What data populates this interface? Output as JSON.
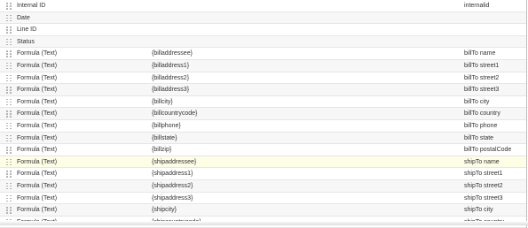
{
  "rows": [
    {
      "field": "Internal ID",
      "formula": "",
      "label": "internalid"
    },
    {
      "field": "Date",
      "formula": "",
      "label": ""
    },
    {
      "field": "Line ID",
      "formula": "",
      "label": ""
    },
    {
      "field": "Status",
      "formula": "",
      "label": ""
    },
    {
      "field": "Formula (Text)",
      "formula": "{billaddressee}",
      "label": "billTo name"
    },
    {
      "field": "Formula (Text)",
      "formula": "{billaddress1}",
      "label": "billTo street1"
    },
    {
      "field": "Formula (Text)",
      "formula": "{billaddress2}",
      "label": "billTo street2"
    },
    {
      "field": "Formula (Text)",
      "formula": "{billaddress3}",
      "label": "billTo street3"
    },
    {
      "field": "Formula (Text)",
      "formula": "{billcity}",
      "label": "billTo city"
    },
    {
      "field": "Formula (Text)",
      "formula": "{billcountrycode}",
      "label": "billTo country"
    },
    {
      "field": "Formula (Text)",
      "formula": "{billphone}",
      "label": "billTo phone"
    },
    {
      "field": "Formula (Text)",
      "formula": "{billstate}",
      "label": "billTo state"
    },
    {
      "field": "Formula (Text)",
      "formula": "{billzip}",
      "label": "billTo postalCode"
    },
    {
      "field": "Formula (Text)",
      "formula": "{shipaddressee}",
      "label": "shipTo name"
    },
    {
      "field": "Formula (Text)",
      "formula": "{shipaddress1}",
      "label": "shipTo street1"
    },
    {
      "field": "Formula (Text)",
      "formula": "{shipaddress2}",
      "label": "shipTo street2"
    },
    {
      "field": "Formula (Text)",
      "formula": "{shipaddress3}",
      "label": "shipTo street3"
    },
    {
      "field": "Formula (Text)",
      "formula": "{shipcity}",
      "label": "shipTo city"
    },
    {
      "field": "Formula (Text)",
      "formula": "{shipcountrycode}",
      "label": "shipTo country"
    }
  ],
  "highlighted_row": 13,
  "colors": {
    "row_alt": "#f7f7f7",
    "row_highlight": "#fefde6",
    "text": "#333333",
    "border": "#e6e6e6"
  },
  "icons": {
    "drag_handle": "drag-handle-icon"
  }
}
